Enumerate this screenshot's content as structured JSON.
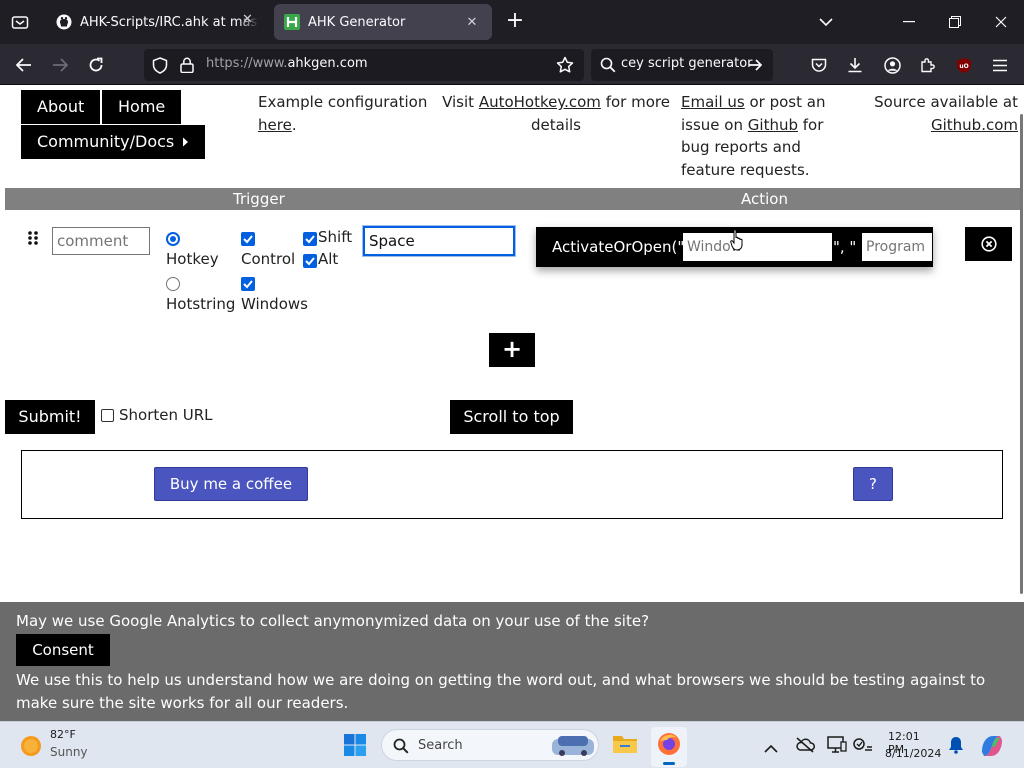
{
  "browser": {
    "tabs": [
      {
        "title": "AHK-Scripts/IRC.ahk at master",
        "active": false,
        "icon": "github-icon"
      },
      {
        "title": "AHK Generator",
        "active": true,
        "icon": "ahk-favicon"
      }
    ],
    "url_prefix": "https://www.",
    "url_host": "ahkgen.com",
    "search_text": "cey script generator"
  },
  "nav": {
    "about": "About",
    "home": "Home",
    "community": "Community/Docs"
  },
  "info": {
    "example_text": "Example configuration",
    "example_link": "here",
    "example_period": ".",
    "visit_text": "Visit",
    "visit_link": "AutoHotkey.com",
    "visit_rest": "for more",
    "visit_details": "details",
    "email_link": "Email us",
    "email_text": "or post an",
    "issue_text": "issue on",
    "github_link": "Github",
    "issue_for": "for",
    "bug_text": "bug reports and",
    "feature_text": "feature requests.",
    "source_text": "Source available at",
    "source_link": "Github.com"
  },
  "table": {
    "trigger_header": "Trigger",
    "action_header": "Action"
  },
  "row": {
    "comment_placeholder": "comment",
    "hotkey_label": "Hotkey",
    "hotstring_label": "Hotstring",
    "control_label": "Control",
    "windows_label": "Windows",
    "shift_label": "Shift",
    "alt_label": "Alt",
    "key_value": "Space",
    "action_function": "ActivateOrOpen(\"",
    "action_separator": "\", \"",
    "window_placeholder": "Window",
    "program_placeholder": "Program",
    "hotkey_selected": true,
    "control_checked": true,
    "windows_checked": true,
    "shift_checked": true,
    "alt_checked": true
  },
  "actions": {
    "add_label": "+",
    "submit_label": "Submit!",
    "shorten_label": "Shorten URL",
    "shorten_checked": false,
    "scroll_top_label": "Scroll to top"
  },
  "support": {
    "coffee_label": "Buy me a coffee",
    "help_label": "?"
  },
  "consent": {
    "question": "May we use Google Analytics to collect anymonymized data on your use of the site?",
    "button": "Consent",
    "explanation": "We use this to help us understand how we are doing on getting the word out, and what browsers we should be testing against to make sure the site works for all our readers."
  },
  "taskbar": {
    "temperature": "82°F",
    "weather": "Sunny",
    "search_label": "Search",
    "time": "12:01 PM",
    "date": "8/11/2024"
  },
  "colors": {
    "accent_blue": "#0060df",
    "coffee_button": "#4a55c0",
    "header_gray": "#808080",
    "consent_gray": "#6b6b6b"
  }
}
